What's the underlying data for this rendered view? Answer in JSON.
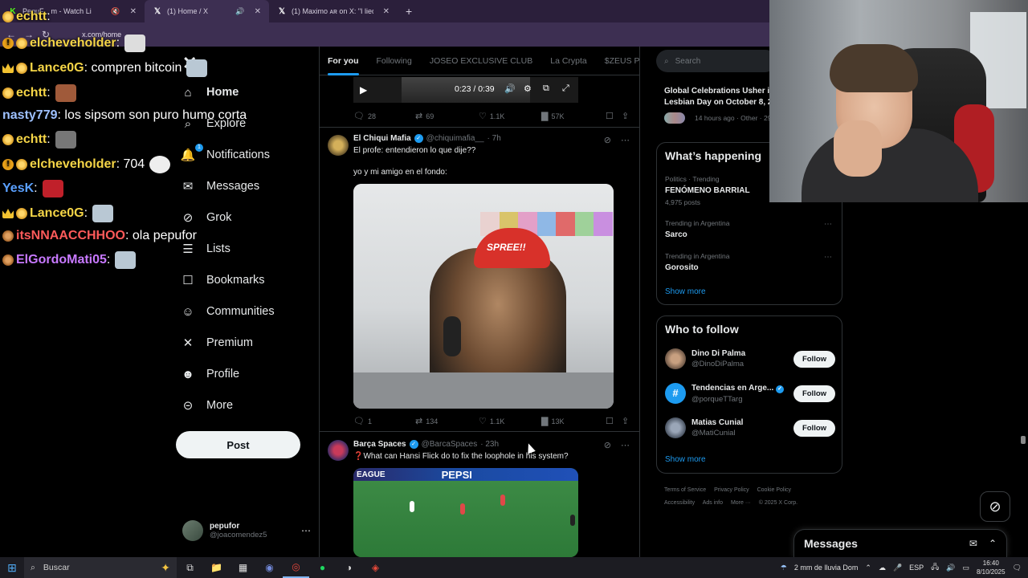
{
  "browser": {
    "tabs": [
      {
        "title": "PepuF... m - Watch Li",
        "active": false
      },
      {
        "title": "(1) Home / X",
        "active": true
      },
      {
        "title": "(1) Maximo ᴀʀ on X: \"I lied its t",
        "active": false
      }
    ],
    "new_tab": "+",
    "url": "x.com/home"
  },
  "chat": [
    {
      "user": "echtt",
      "color": "#f5d547",
      "text": "",
      "badges": [
        "coin"
      ]
    },
    {
      "user": "elcheveholder",
      "color": "#f5d547",
      "text": "",
      "badges": [
        "info",
        "coin"
      ]
    },
    {
      "user": "Lance0G",
      "color": "#f5d547",
      "text": "compren bitcoin",
      "badges": [
        "crown",
        "coin"
      ]
    },
    {
      "user": "echtt",
      "color": "#f5d547",
      "text": "",
      "badges": [
        "coin"
      ]
    },
    {
      "user": "nasty779",
      "color": "#9ec1ff",
      "text": "los sipsom son puro humo corta",
      "badges": []
    },
    {
      "user": "echtt",
      "color": "#f5d547",
      "text": "",
      "badges": [
        "coin"
      ]
    },
    {
      "user": "elcheveholder",
      "color": "#f5d547",
      "text": "704",
      "badges": [
        "info",
        "coin"
      ]
    },
    {
      "user": "YesK",
      "color": "#5aa0ff",
      "text": "",
      "badges": []
    },
    {
      "user": "Lance0G",
      "color": "#f5d547",
      "text": "",
      "badges": [
        "crown",
        "coin"
      ]
    },
    {
      "user": "itsNNAACCHHOO",
      "color": "#ff5a5a",
      "text": "ola pepufor",
      "badges": [
        "bronze"
      ]
    },
    {
      "user": "ElGordoMati05",
      "color": "#c879ff",
      "text": "",
      "badges": [
        "bronze"
      ]
    }
  ],
  "nav": {
    "items": [
      {
        "label": "Home",
        "icon": "home-icon"
      },
      {
        "label": "Explore",
        "icon": "search-icon"
      },
      {
        "label": "Notifications",
        "icon": "bell-icon",
        "badge": "1"
      },
      {
        "label": "Messages",
        "icon": "envelope-icon"
      },
      {
        "label": "Grok",
        "icon": "grok-icon"
      },
      {
        "label": "Lists",
        "icon": "list-icon"
      },
      {
        "label": "Bookmarks",
        "icon": "bookmark-icon"
      },
      {
        "label": "Communities",
        "icon": "people-icon"
      },
      {
        "label": "Premium",
        "icon": "x-logo-icon"
      },
      {
        "label": "Profile",
        "icon": "person-icon"
      },
      {
        "label": "More",
        "icon": "more-circle-icon"
      }
    ],
    "post_label": "Post",
    "account": {
      "name": "pepufor",
      "handle": "@joacomendez5"
    }
  },
  "timeline": {
    "tabs": [
      "For you",
      "Following",
      "JOSEO EXCLUSIVE CLUB",
      "La Crypta",
      "$ZEUS Pepe's"
    ],
    "video_time": "0:23 / 0:39",
    "top_actions": {
      "replies": "28",
      "reposts": "69",
      "likes": "1.1K",
      "views": "57K"
    },
    "tweets": [
      {
        "name": "El Chiqui Mafia",
        "handle": "@chiquimafia__",
        "time": "· 7h",
        "lines": [
          "El profe: entendieron lo que dije??",
          "yo y mi amigo en el fondo:"
        ],
        "cap_text": "SPREE!!",
        "actions": {
          "replies": "1",
          "reposts": "134",
          "likes": "1.1K",
          "views": "13K"
        }
      },
      {
        "name": "Barça Spaces",
        "handle": "@BarcaSpaces",
        "time": "· 23h",
        "lines": [
          "❓What can Hansi Flick do to fix the loophole in his system?"
        ],
        "media_banner": [
          "EAGUE",
          "PEPSI"
        ]
      }
    ]
  },
  "right": {
    "search_placeholder": "Search",
    "top_trend": {
      "title_1": "Global Celebrations Usher i",
      "title_2": "Lesbian Day on October 8, 2",
      "meta": "14 hours ago · Other · 29"
    },
    "happening_title": "What’s happening",
    "trends": [
      {
        "category": "Politics · Trending",
        "title": "FENÓMENO BARRIAL",
        "count": "4,975 posts"
      },
      {
        "category": "Trending in Argentina",
        "title": "Sarco",
        "count": ""
      },
      {
        "category": "Trending in Argentina",
        "title": "Gorosito",
        "count": ""
      }
    ],
    "show_more": "Show more",
    "who_to_follow_title": "Who to follow",
    "follow_suggestions": [
      {
        "name": "Dino Di Palma",
        "handle": "@DinoDiPalma",
        "verified": false
      },
      {
        "name": "Tendencias en Arge...",
        "handle": "@porqueTTarg",
        "verified": true
      },
      {
        "name": "Matias Cunial",
        "handle": "@MatiCunial",
        "verified": false
      }
    ],
    "follow_label": "Follow",
    "footer": [
      "Terms of Service",
      "Privacy Policy",
      "Cookie Policy",
      "Accessibility",
      "Ads info",
      "More ···",
      "© 2025 X Corp."
    ],
    "messages_title": "Messages"
  },
  "taskbar": {
    "search_label": "Buscar",
    "weather": "2 mm de lluvia Dom",
    "lang": "ESP",
    "time": "16:40",
    "date": "8/10/2025"
  },
  "colors": {
    "accent": "#1d9bf0",
    "background": "#000000",
    "border": "#2f3336",
    "muted": "#71767b"
  }
}
